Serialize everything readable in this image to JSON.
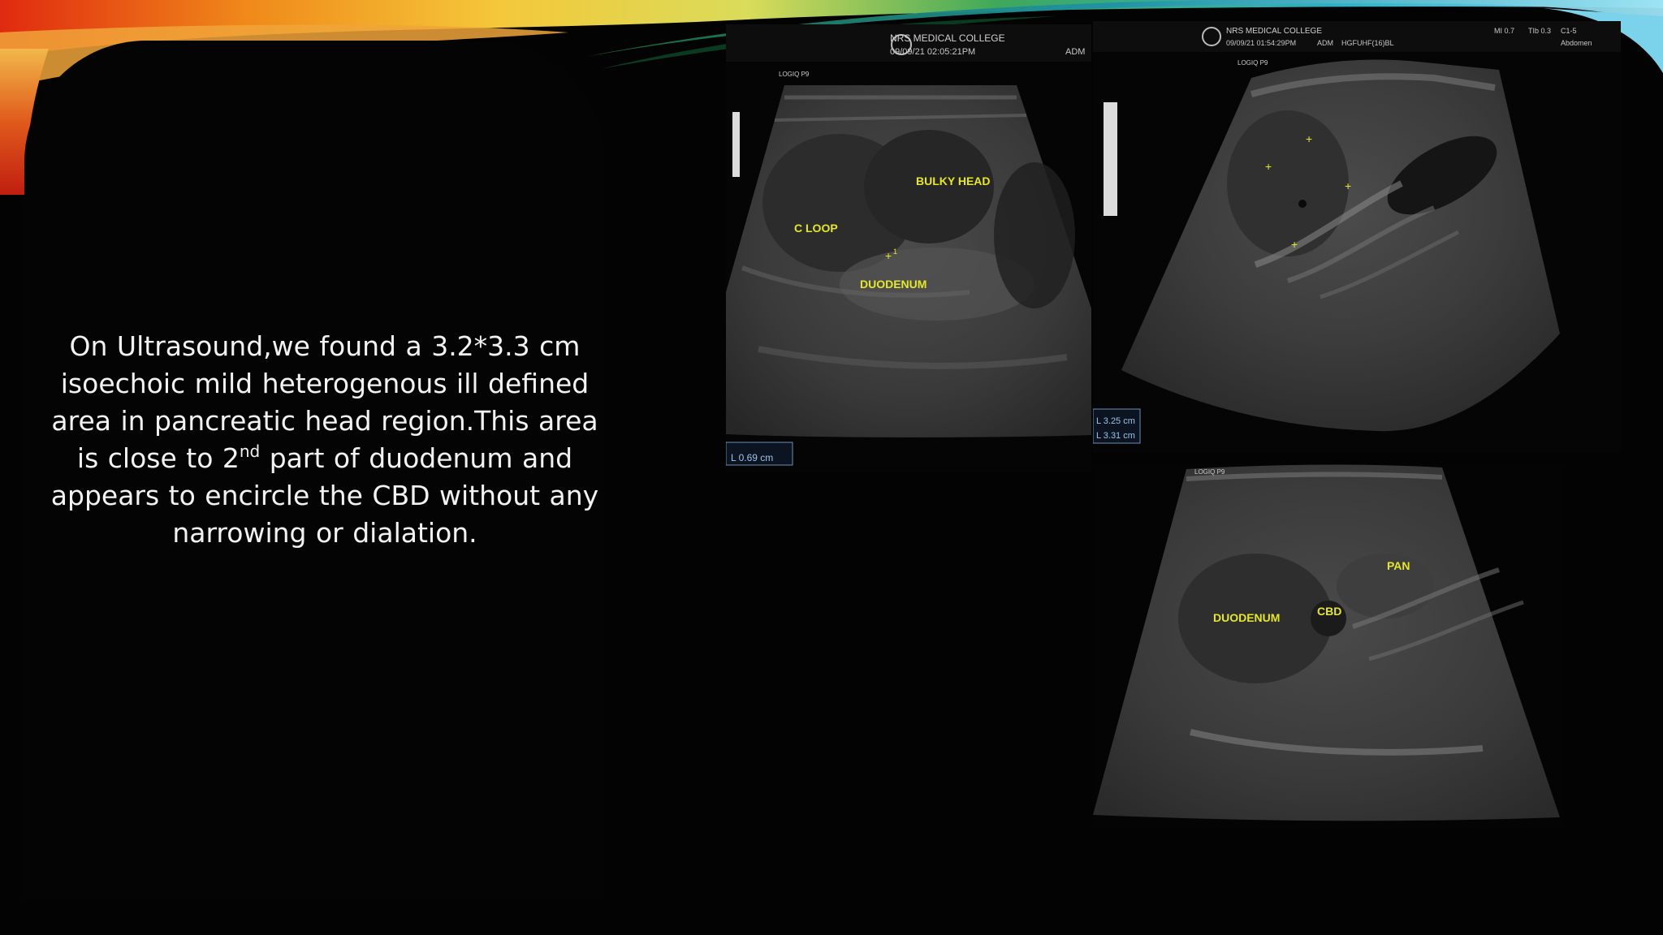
{
  "slide": {
    "body_before_sup": "On Ultrasound,we found a 3.2*3.3 cm isoechoic mild  heterogenous ill defined area in pancreatic head region.This area is close to 2",
    "body_sup": "nd",
    "body_after_sup": " part of duodenum and appears to encircle the CBD without any narrowing or dialation."
  },
  "images": {
    "left": {
      "institution": "NRS MEDICAL COLLEGE",
      "datetime": "09/09/21 02:05:21PM",
      "operator": "ADM",
      "probe_label": "LOGIQ P9",
      "labels": {
        "bulky_head": "BULKY HEAD",
        "c_loop": "C LOOP",
        "duodenum": "DUODENUM"
      },
      "measure_marker": "1",
      "measurement": "L  0.69 cm"
    },
    "top_right": {
      "institution": "NRS MEDICAL COLLEGE",
      "datetime": "09/09/21 01:54:29PM",
      "operator": "ADM",
      "preset": "HGFUHF(16)BL",
      "params": [
        "MI 0.7",
        "TIb 0.3",
        "C1-5",
        "Abdomen"
      ],
      "probe_label": "LOGIQ P9",
      "measurements": [
        "L  3.25 cm",
        "L  3.31 cm"
      ]
    },
    "bottom_right": {
      "probe_label": "LOGIQ P9",
      "labels": {
        "pan": "PAN",
        "cbd": "CBD",
        "duodenum": "DUODENUM"
      }
    }
  },
  "colors": {
    "background": "#030303",
    "text": "#f2f2f2",
    "annotation": "#e6e62a",
    "measurement": "#9ec3e8"
  }
}
